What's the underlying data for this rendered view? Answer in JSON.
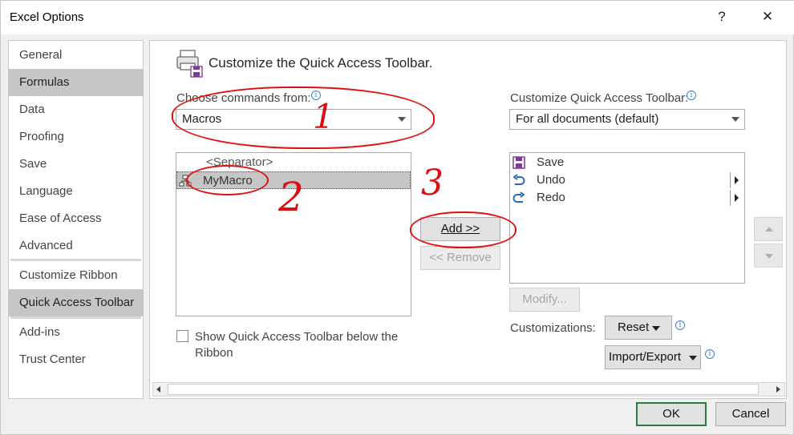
{
  "window": {
    "title": "Excel Options",
    "help_label": "?",
    "close_label": "✕"
  },
  "sidebar": {
    "items": [
      {
        "label": "General"
      },
      {
        "label": "Formulas"
      },
      {
        "label": "Data"
      },
      {
        "label": "Proofing"
      },
      {
        "label": "Save"
      },
      {
        "label": "Language"
      },
      {
        "label": "Ease of Access"
      },
      {
        "label": "Advanced"
      },
      {
        "label": "Customize Ribbon"
      },
      {
        "label": "Quick Access Toolbar"
      },
      {
        "label": "Add-ins"
      },
      {
        "label": "Trust Center"
      }
    ],
    "selected": "Quick Access Toolbar"
  },
  "main": {
    "heading": "Customize the Quick Access Toolbar.",
    "choose_label": "Choose commands from:",
    "choose_value": "Macros",
    "customize_label": "Customize Quick Access Toolbar:",
    "customize_value": "For all documents (default)",
    "commands": [
      {
        "label": "<Separator>"
      },
      {
        "label": "MyMacro"
      }
    ],
    "toolbar_items": [
      {
        "label": "Save",
        "icon": "save-icon"
      },
      {
        "label": "Undo",
        "icon": "undo-icon"
      },
      {
        "label": "Redo",
        "icon": "redo-icon"
      }
    ],
    "add_label": "Add >>",
    "remove_label": "<< Remove",
    "modify_label": "Modify...",
    "customizations_label": "Customizations:",
    "reset_label": "Reset",
    "import_export_label": "Import/Export",
    "show_below_label": "Show Quick Access Toolbar below the Ribbon",
    "show_below_checked": false
  },
  "annotations": [
    {
      "number": "1"
    },
    {
      "number": "2"
    },
    {
      "number": "3"
    }
  ],
  "footer": {
    "ok_label": "OK",
    "cancel_label": "Cancel"
  },
  "colors": {
    "annotation": "#e01010",
    "selection": "#c6c6c6",
    "default_button_border": "#2c7a3e",
    "info_icon": "#3d7fd0"
  }
}
